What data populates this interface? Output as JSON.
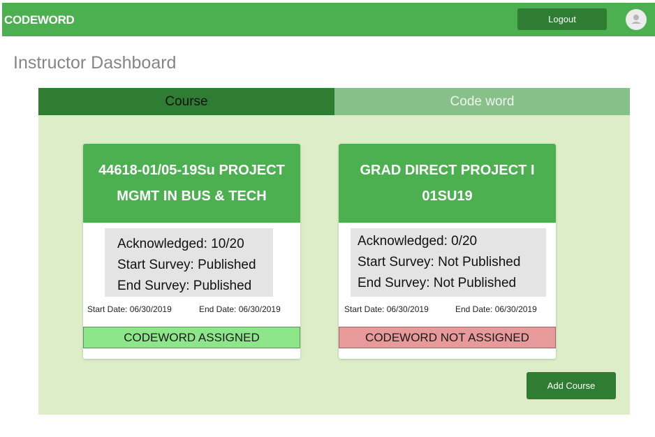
{
  "header": {
    "brand": "CODEWORD",
    "logout_label": "Logout"
  },
  "page_title": "Instructor Dashboard",
  "tabs": [
    {
      "label": "Course"
    },
    {
      "label": "Code word"
    }
  ],
  "courses": [
    {
      "title": "44618-01/05-19Su PROJECT MGMT IN BUS & TECH",
      "acknowledged": "Acknowledged: 10/20",
      "start_survey": "Start Survey: Published",
      "end_survey": "End Survey: Published",
      "start_date": "Start Date: 06/30/2019",
      "end_date": "End Date: 06/30/2019",
      "status": "CODEWORD ASSIGNED"
    },
    {
      "title": "GRAD DIRECT PROJECT I 01SU19",
      "acknowledged": "Acknowledged: 0/20",
      "start_survey": "Start Survey: Not Published",
      "end_survey": "End Survey: Not Published",
      "start_date": "Start Date: 06/30/2019",
      "end_date": "End Date: 06/30/2019",
      "status": "CODEWORD NOT ASSIGNED"
    }
  ],
  "add_course_label": "Add Course",
  "colors": {
    "primary": "#4caf50",
    "primary_dark": "#2e7d32",
    "panel_bg": "#dcedc8",
    "assigned": "#8de68a",
    "not_assigned": "#e89a9a"
  },
  "icons": {
    "avatar": "person-icon"
  }
}
